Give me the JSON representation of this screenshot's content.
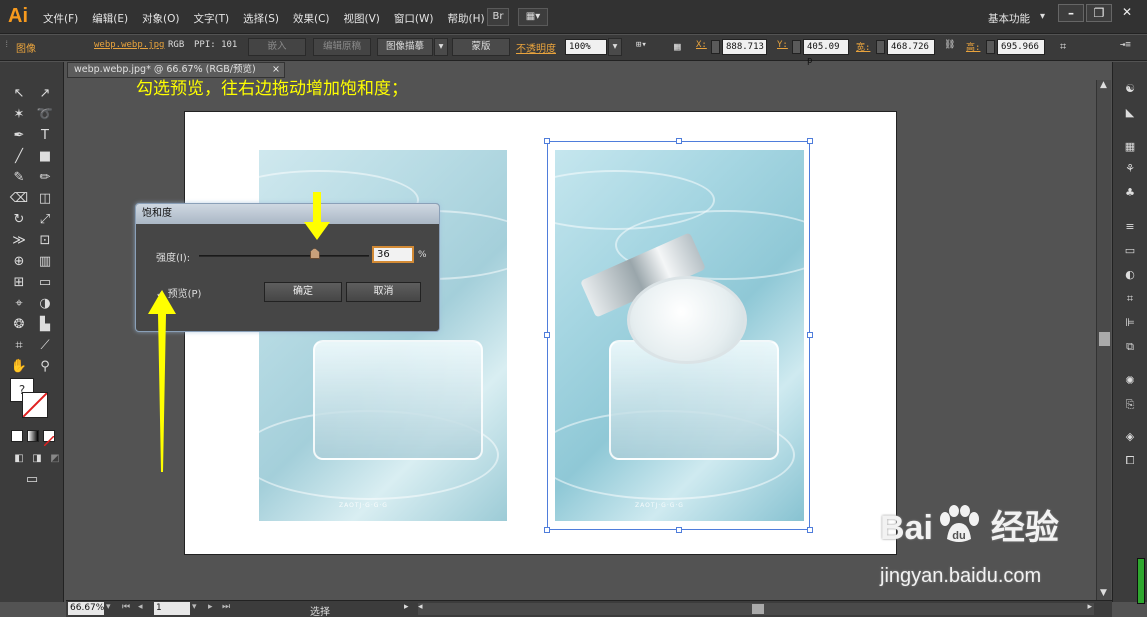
{
  "app": {
    "logo": "Ai",
    "workspace": "基本功能"
  },
  "menu": [
    "文件(F)",
    "编辑(E)",
    "对象(O)",
    "文字(T)",
    "选择(S)",
    "效果(C)",
    "视图(V)",
    "窗口(W)",
    "帮助(H)"
  ],
  "window_controls": {
    "minimize": "–",
    "restore": "❐",
    "close": "✕"
  },
  "controlbar": {
    "object_type": "图像",
    "link_name": "webp.webp.jpg",
    "color_mode": "RGB",
    "ppi": "PPI: 101",
    "embed": "嵌入",
    "edit_original": "编辑原稿",
    "image_trace": "图像描摹",
    "mask": "蒙版",
    "opacity_label": "不透明度",
    "opacity_value": "100%",
    "x_label": "X:",
    "x_value": "888.713",
    "y_label": "Y:",
    "y_value": "405.09 p",
    "w_label": "宽:",
    "w_value": "468.726",
    "h_label": "高:",
    "h_value": "695.966"
  },
  "document": {
    "tab_title": "webp.webp.jpg* @ 66.67% (RGB/预览)",
    "close": "×"
  },
  "instruction": "勾选预览，往右边拖动增加饱和度；",
  "dialog": {
    "title": "饱和度",
    "intensity_label": "强度(I):",
    "intensity_value": "36",
    "percent": "%",
    "preview_label": "预览(P)",
    "preview_checked": true,
    "ok": "确定",
    "cancel": "取消"
  },
  "photo_watermark": "ZAOTJ·G·G·G",
  "status": {
    "zoom": "66.67%",
    "page": "1",
    "tool": "选择"
  },
  "watermark": {
    "brand": "Bai",
    "brand2": "经验",
    "url": "jingyan.baidu.com"
  },
  "colors": {
    "instruction": "#ffff00",
    "selection": "#4f7ddb",
    "accent": "#e8a33d"
  }
}
